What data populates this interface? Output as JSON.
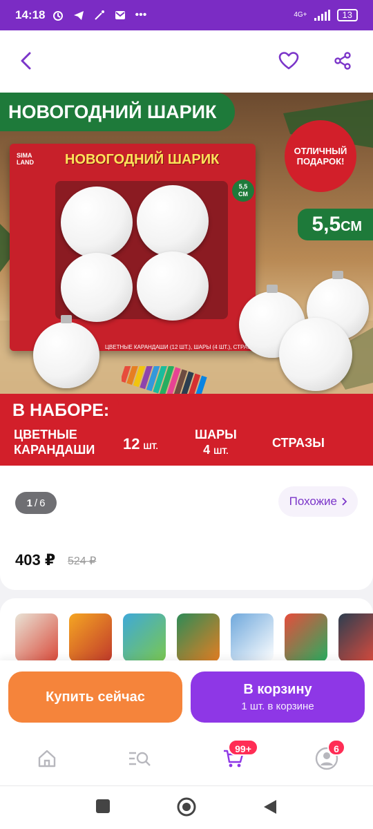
{
  "status_bar": {
    "time": "14:18",
    "network": "4G+",
    "battery": "13"
  },
  "top_nav": {
    "back_icon": "chevron-left-icon",
    "favorite_icon": "heart-icon",
    "share_icon": "share-icon"
  },
  "product_image": {
    "headline": "НОВОГОДНИЙ ШАРИК",
    "badge": [
      "ОТЛИЧНЫЙ",
      "ПОДАРОК!"
    ],
    "size": "5,5",
    "size_unit": "СМ",
    "box_title": "НОВОГОДНИЙ ШАРИК",
    "box_brand": [
      "SIMA",
      "LAND"
    ],
    "box_size": [
      "5,5",
      "СМ"
    ],
    "box_caption": "ЦВЕТНЫЕ КАРАНДАШИ (12 ШТ.), ШАРЫ (4 ШТ.), СТРАЗЫ",
    "in_set_label": "В НАБОРЕ:",
    "pencils_label": [
      "ЦВЕТНЫЕ",
      "КАРАНДАШИ"
    ],
    "pencils_qty": "12",
    "pencils_unit": "ШТ.",
    "balls_label": "ШАРЫ",
    "balls_qty": "4",
    "balls_unit": "ШТ.",
    "rhinestones_label": "СТРАЗЫ"
  },
  "gallery": {
    "current": "1",
    "separator": "/",
    "total": "6"
  },
  "similar_button": {
    "label": "Похожие",
    "icon": "chevron-right-icon"
  },
  "price": {
    "current": "403 ₽",
    "old": "524 ₽"
  },
  "related_thumbnails": [
    {
      "colors": [
        "#e9e3d6",
        "#d94a3a"
      ]
    },
    {
      "colors": [
        "#f5a623",
        "#c0392b"
      ]
    },
    {
      "colors": [
        "#3fa9d8",
        "#7ac74f"
      ]
    },
    {
      "colors": [
        "#2e8b57",
        "#e67e22"
      ]
    },
    {
      "colors": [
        "#6fa8dc",
        "#ffffff"
      ]
    },
    {
      "colors": [
        "#e74c3c",
        "#27ae60"
      ]
    },
    {
      "colors": [
        "#2c3e50",
        "#e74c3c"
      ]
    }
  ],
  "actions": {
    "buy_now": "Купить сейчас",
    "add_to_cart": "В корзину",
    "cart_status": "1 шт. в корзине"
  },
  "tab_bar": {
    "home_icon": "home-icon",
    "catalog_icon": "catalog-search-icon",
    "cart_icon": "cart-icon",
    "cart_badge": "99+",
    "profile_icon": "profile-icon",
    "profile_badge": "6"
  },
  "colors": {
    "accent_purple": "#8e37e6",
    "buy_orange": "#f5843b",
    "status_bar": "#7b2cc4",
    "badge_red": "#ff2d55"
  }
}
